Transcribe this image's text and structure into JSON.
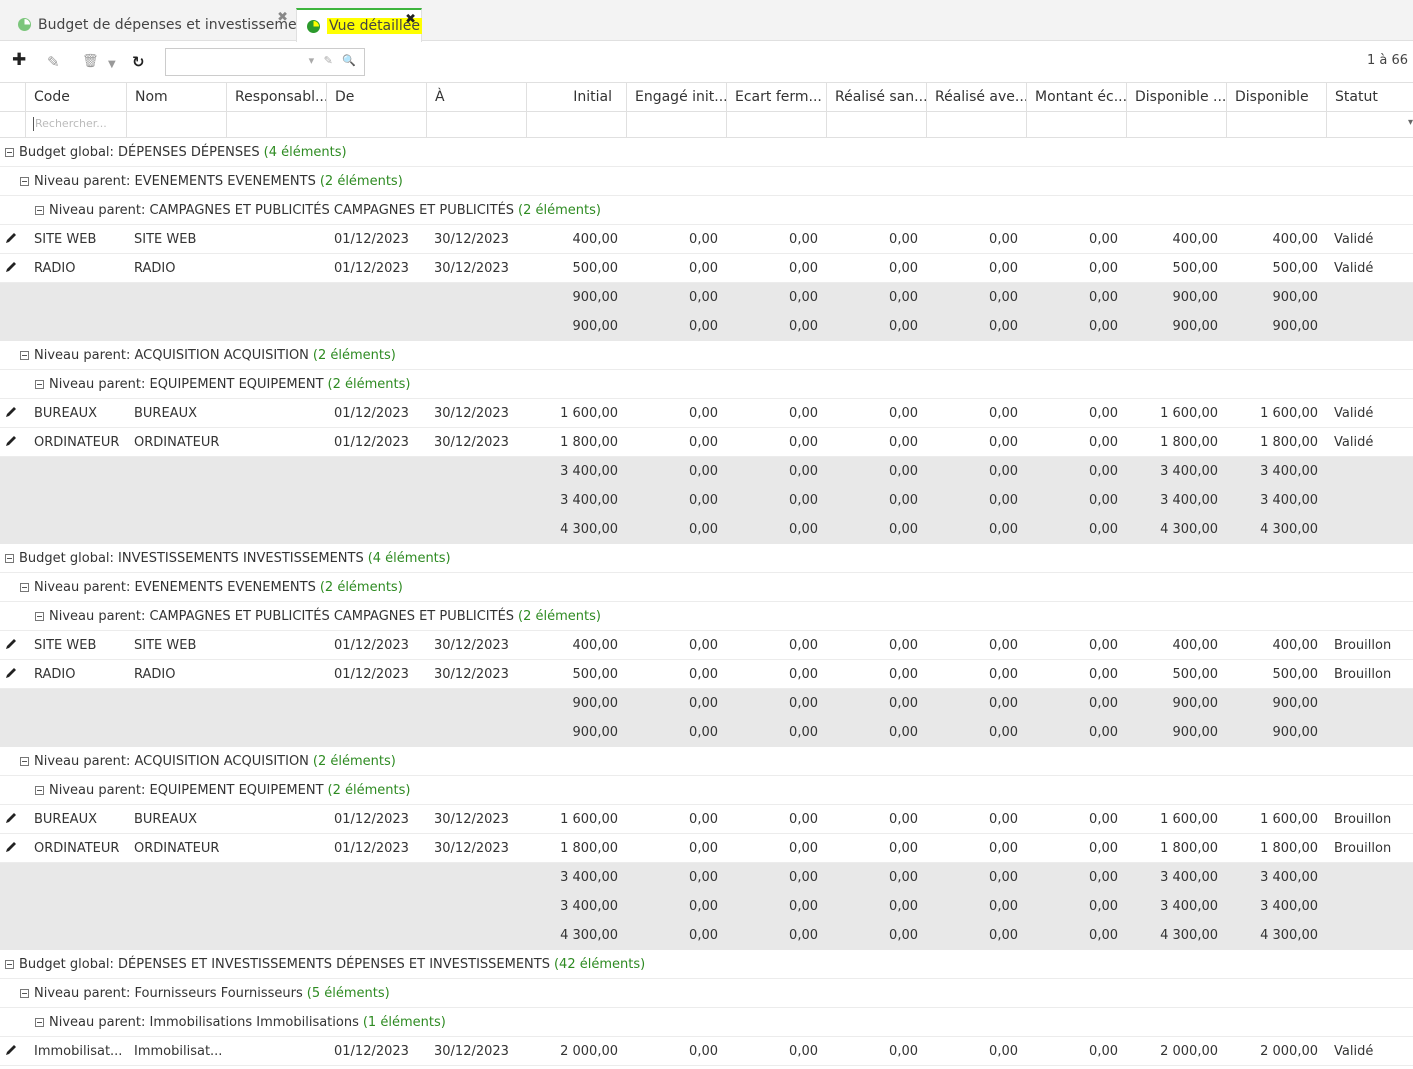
{
  "tabs": [
    {
      "label": "Budget de dépenses et investissements"
    },
    {
      "label": "Vue détaillée"
    }
  ],
  "toolbar": {
    "pager": "1 à 66",
    "search_value": ""
  },
  "columns": [
    "Code",
    "Nom",
    "Responsabl...",
    "De",
    "À",
    "Initial",
    "Engagé init...",
    "Ecart ferm...",
    "Réalisé san...",
    "Réalisé ave...",
    "Montant éc...",
    "Disponible ...",
    "Disponible",
    "Statut"
  ],
  "filter": {
    "code_placeholder": "Rechercher..."
  },
  "rows": [
    {
      "type": "group",
      "level": 0,
      "label": "Budget global: DÉPENSES DÉPENSES",
      "count": "(4 éléments)"
    },
    {
      "type": "group",
      "level": 1,
      "label": "Niveau parent: EVENEMENTS EVENEMENTS",
      "count": "(2 éléments)"
    },
    {
      "type": "group",
      "level": 2,
      "label": "Niveau parent: CAMPAGNES ET PUBLICITÉS CAMPAGNES ET PUBLICITÉS",
      "count": "(2 éléments)"
    },
    {
      "type": "data",
      "code": "SITE WEB",
      "nom": "SITE WEB",
      "resp": "",
      "de": "01/12/2023",
      "a": "30/12/2023",
      "vals": [
        "400,00",
        "0,00",
        "0,00",
        "0,00",
        "0,00",
        "0,00",
        "400,00",
        "400,00"
      ],
      "statut": "Validé"
    },
    {
      "type": "data",
      "code": "RADIO",
      "nom": "RADIO",
      "resp": "",
      "de": "01/12/2023",
      "a": "30/12/2023",
      "vals": [
        "500,00",
        "0,00",
        "0,00",
        "0,00",
        "0,00",
        "0,00",
        "500,00",
        "500,00"
      ],
      "statut": "Validé"
    },
    {
      "type": "sum",
      "vals": [
        "900,00",
        "0,00",
        "0,00",
        "0,00",
        "0,00",
        "0,00",
        "900,00",
        "900,00"
      ]
    },
    {
      "type": "sum",
      "vals": [
        "900,00",
        "0,00",
        "0,00",
        "0,00",
        "0,00",
        "0,00",
        "900,00",
        "900,00"
      ]
    },
    {
      "type": "group",
      "level": 1,
      "label": "Niveau parent: ACQUISITION ACQUISITION",
      "count": "(2 éléments)"
    },
    {
      "type": "group",
      "level": 2,
      "label": "Niveau parent: EQUIPEMENT EQUIPEMENT",
      "count": "(2 éléments)"
    },
    {
      "type": "data",
      "code": "BUREAUX",
      "nom": "BUREAUX",
      "resp": "",
      "de": "01/12/2023",
      "a": "30/12/2023",
      "vals": [
        "1 600,00",
        "0,00",
        "0,00",
        "0,00",
        "0,00",
        "0,00",
        "1 600,00",
        "1 600,00"
      ],
      "statut": "Validé"
    },
    {
      "type": "data",
      "code": "ORDINATEUR",
      "nom": "ORDINATEUR",
      "resp": "",
      "de": "01/12/2023",
      "a": "30/12/2023",
      "vals": [
        "1 800,00",
        "0,00",
        "0,00",
        "0,00",
        "0,00",
        "0,00",
        "1 800,00",
        "1 800,00"
      ],
      "statut": "Validé"
    },
    {
      "type": "sum",
      "vals": [
        "3 400,00",
        "0,00",
        "0,00",
        "0,00",
        "0,00",
        "0,00",
        "3 400,00",
        "3 400,00"
      ]
    },
    {
      "type": "sum",
      "vals": [
        "3 400,00",
        "0,00",
        "0,00",
        "0,00",
        "0,00",
        "0,00",
        "3 400,00",
        "3 400,00"
      ]
    },
    {
      "type": "sum",
      "vals": [
        "4 300,00",
        "0,00",
        "0,00",
        "0,00",
        "0,00",
        "0,00",
        "4 300,00",
        "4 300,00"
      ]
    },
    {
      "type": "group",
      "level": 0,
      "label": "Budget global: INVESTISSEMENTS INVESTISSEMENTS",
      "count": "(4 éléments)"
    },
    {
      "type": "group",
      "level": 1,
      "label": "Niveau parent: EVENEMENTS EVENEMENTS",
      "count": "(2 éléments)"
    },
    {
      "type": "group",
      "level": 2,
      "label": "Niveau parent: CAMPAGNES ET PUBLICITÉS CAMPAGNES ET PUBLICITÉS",
      "count": "(2 éléments)"
    },
    {
      "type": "data",
      "code": "SITE WEB",
      "nom": "SITE WEB",
      "resp": "",
      "de": "01/12/2023",
      "a": "30/12/2023",
      "vals": [
        "400,00",
        "0,00",
        "0,00",
        "0,00",
        "0,00",
        "0,00",
        "400,00",
        "400,00"
      ],
      "statut": "Brouillon"
    },
    {
      "type": "data",
      "code": "RADIO",
      "nom": "RADIO",
      "resp": "",
      "de": "01/12/2023",
      "a": "30/12/2023",
      "vals": [
        "500,00",
        "0,00",
        "0,00",
        "0,00",
        "0,00",
        "0,00",
        "500,00",
        "500,00"
      ],
      "statut": "Brouillon"
    },
    {
      "type": "sum",
      "vals": [
        "900,00",
        "0,00",
        "0,00",
        "0,00",
        "0,00",
        "0,00",
        "900,00",
        "900,00"
      ]
    },
    {
      "type": "sum",
      "vals": [
        "900,00",
        "0,00",
        "0,00",
        "0,00",
        "0,00",
        "0,00",
        "900,00",
        "900,00"
      ]
    },
    {
      "type": "group",
      "level": 1,
      "label": "Niveau parent: ACQUISITION ACQUISITION",
      "count": "(2 éléments)"
    },
    {
      "type": "group",
      "level": 2,
      "label": "Niveau parent: EQUIPEMENT EQUIPEMENT",
      "count": "(2 éléments)"
    },
    {
      "type": "data",
      "code": "BUREAUX",
      "nom": "BUREAUX",
      "resp": "",
      "de": "01/12/2023",
      "a": "30/12/2023",
      "vals": [
        "1 600,00",
        "0,00",
        "0,00",
        "0,00",
        "0,00",
        "0,00",
        "1 600,00",
        "1 600,00"
      ],
      "statut": "Brouillon"
    },
    {
      "type": "data",
      "code": "ORDINATEUR",
      "nom": "ORDINATEUR",
      "resp": "",
      "de": "01/12/2023",
      "a": "30/12/2023",
      "vals": [
        "1 800,00",
        "0,00",
        "0,00",
        "0,00",
        "0,00",
        "0,00",
        "1 800,00",
        "1 800,00"
      ],
      "statut": "Brouillon"
    },
    {
      "type": "sum",
      "vals": [
        "3 400,00",
        "0,00",
        "0,00",
        "0,00",
        "0,00",
        "0,00",
        "3 400,00",
        "3 400,00"
      ]
    },
    {
      "type": "sum",
      "vals": [
        "3 400,00",
        "0,00",
        "0,00",
        "0,00",
        "0,00",
        "0,00",
        "3 400,00",
        "3 400,00"
      ]
    },
    {
      "type": "sum",
      "vals": [
        "4 300,00",
        "0,00",
        "0,00",
        "0,00",
        "0,00",
        "0,00",
        "4 300,00",
        "4 300,00"
      ]
    },
    {
      "type": "group",
      "level": 0,
      "label": "Budget global: DÉPENSES ET INVESTISSEMENTS DÉPENSES ET INVESTISSEMENTS",
      "count": "(42 éléments)"
    },
    {
      "type": "group",
      "level": 1,
      "label": "Niveau parent: Fournisseurs Fournisseurs",
      "count": "(5 éléments)"
    },
    {
      "type": "group",
      "level": 2,
      "label": "Niveau parent: Immobilisations Immobilisations",
      "count": "(1 éléments)"
    },
    {
      "type": "data",
      "code": "Immobilisat...",
      "nom": "Immobilisat...",
      "resp": "",
      "de": "01/12/2023",
      "a": "30/12/2023",
      "vals": [
        "2 000,00",
        "0,00",
        "0,00",
        "0,00",
        "0,00",
        "0,00",
        "2 000,00",
        "2 000,00"
      ],
      "statut": "Validé"
    }
  ]
}
